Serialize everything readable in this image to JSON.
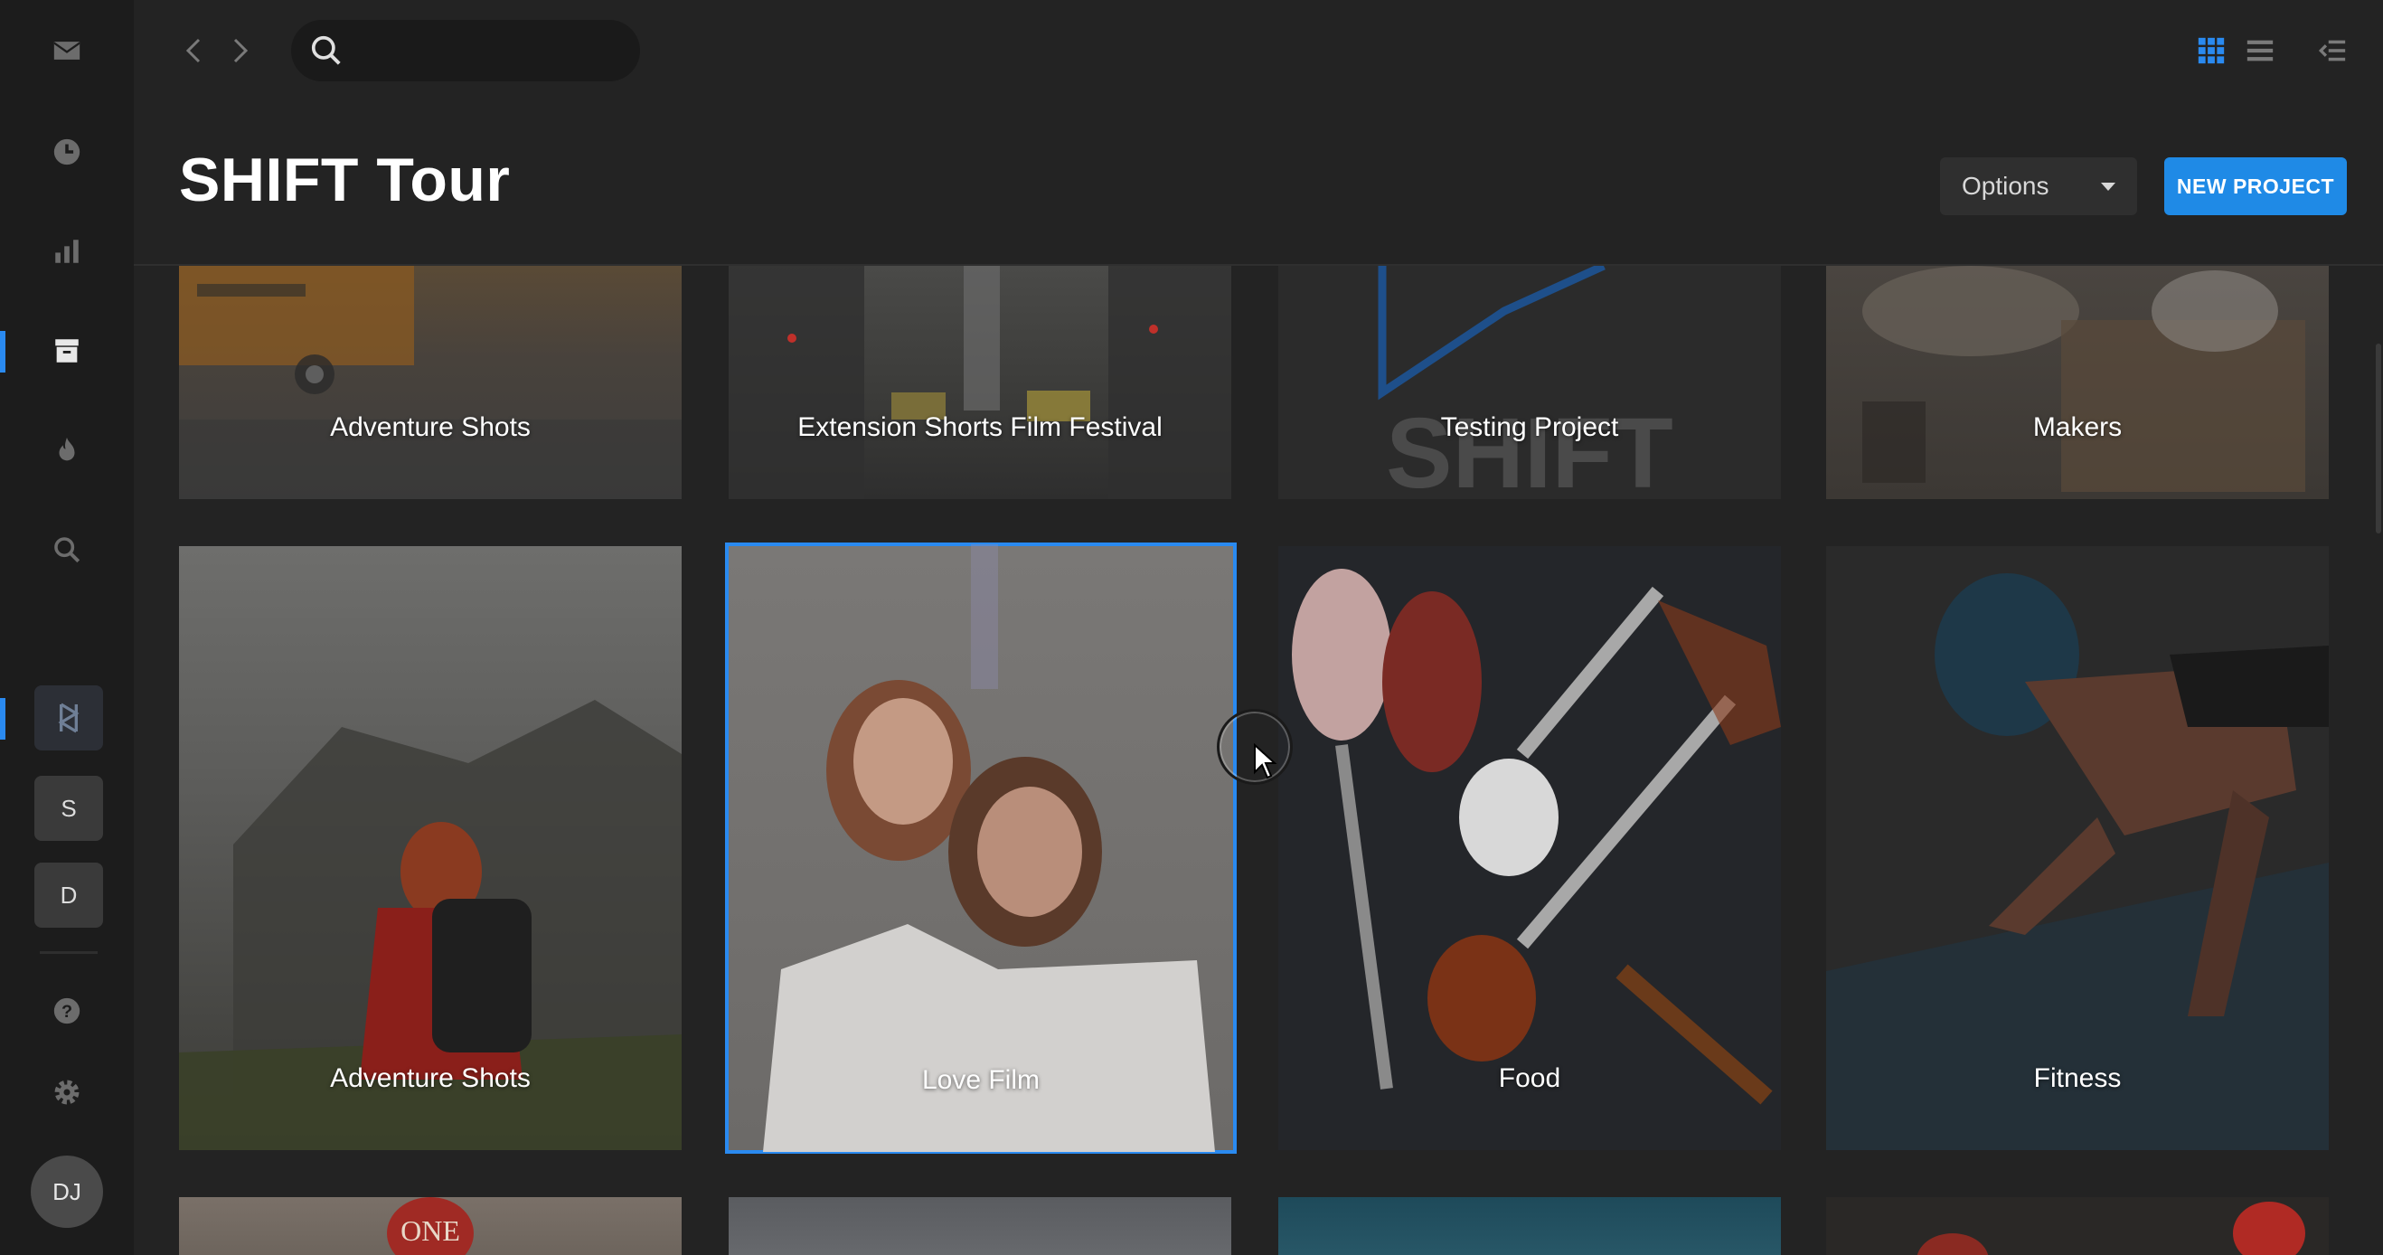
{
  "sidebar": {
    "icons": [
      "mail-icon",
      "clock-icon",
      "bar-chart-icon",
      "archive-icon",
      "flame-icon",
      "search-icon"
    ],
    "workspaces": [
      {
        "label": "S"
      },
      {
        "label": "D"
      }
    ],
    "bottom_icons": [
      "help-icon",
      "gear-icon"
    ],
    "avatar": "DJ"
  },
  "topbar": {
    "search_placeholder": "",
    "view_icons": [
      "grid-view-icon",
      "list-view-icon",
      "collapse-panel-icon"
    ]
  },
  "header": {
    "title": "SHIFT Tour",
    "options_label": "Options",
    "new_project_label": "NEW PROJECT"
  },
  "colors": {
    "accent": "#2a8af0",
    "background": "#232323",
    "sidebar": "#1c1c1c"
  },
  "projects": [
    {
      "title": "Adventure Shots"
    },
    {
      "title": "Extension Shorts Film Festival"
    },
    {
      "title": "Testing Project",
      "watermark": "SHIFT"
    },
    {
      "title": "Makers"
    },
    {
      "title": "Adventure Shots"
    },
    {
      "title": "Love Film",
      "selected": true
    },
    {
      "title": "Food"
    },
    {
      "title": "Fitness"
    },
    {
      "title": "",
      "badge": "ONE"
    },
    {
      "title": ""
    },
    {
      "title": ""
    },
    {
      "title": ""
    }
  ]
}
